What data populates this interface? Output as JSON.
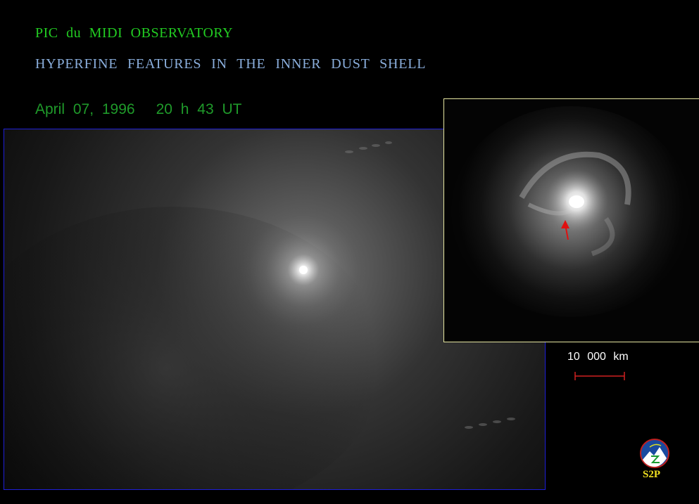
{
  "title_line1": "PIC du MIDI OBSERVATORY",
  "title_line2": "HYPERFINE FEATURES IN THE INNER DUST SHELL",
  "date": "April 07, 1996",
  "time": "20 h 43 UT",
  "scale_label": "10 000 km",
  "logo_text": "S2P",
  "colors": {
    "title1": "#22cc22",
    "title2": "#8aaedc",
    "datetime": "#1f9a2a",
    "main_frame_border": "#1f1fd6",
    "inset_frame_border": "#e6e6a0",
    "scale_label": "#ffffff",
    "scale_bar": "#d02020",
    "arrow": "#e01010",
    "logo_text": "#f0e020"
  },
  "icons": {
    "logo": "s2p-logo-icon",
    "arrow": "red-arrow-icon"
  }
}
